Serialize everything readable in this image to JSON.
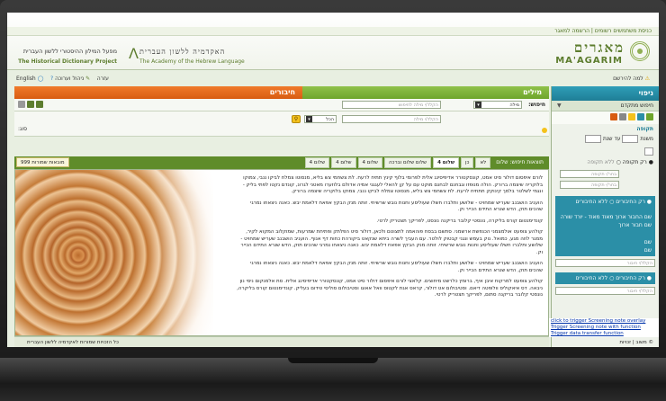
{
  "header": {
    "topnav": "כניסת משתמשים רשומים | הרשמה למאגר",
    "brand_he": "מאגרים",
    "brand_en": "MA'AGARIM",
    "academy_he_1": "האקדמיה ללשון העברית",
    "academy_he_2": "מפעל המילון ההיסטורי ללשון העברית",
    "academy_en_1": "The Academy of the Hebrew Language",
    "academy_en_2": "The Historical Dictionary Project",
    "links_left": [
      "English",
      "עזרה",
      "ניהול וערוכה"
    ],
    "link_right": "למה להירשם"
  },
  "right_panel": {
    "title": "ניפוי",
    "sub": "חיפוש מתקדם",
    "period_label": "תקופה",
    "from_label": "משנת",
    "to_label": "עד שנת",
    "only_period": "רק תקופה",
    "not_period": "ללא תקופה",
    "period_box_1": "בחר/י תקופה",
    "period_box_2": "בחר/י תקופה",
    "only_works": "רק החיבורים",
    "no_works": "ללא החיבורים",
    "work_opt_1": "שם החבור ארוך מאוד מאוד - יורד שורה",
    "work_opt_2": "שם חבור ארוך",
    "work_opt_3": "שם",
    "work_opt_4": "שם",
    "works_box": "הקלד/י חיבור",
    "only_works_2": "רק החיבורים",
    "no_works_2": "ללא החיבורים",
    "works_box_2": "הקלד/י חיבור"
  },
  "main": {
    "tab_words": "מילים",
    "tab_works": "חיבורים",
    "search_label": "חיפוש:",
    "search_type": "מילה",
    "search_placeholder": "הקלד/י מילה לחיפוש",
    "all_label": "הכל",
    "word_placeholder": "הקלד/י מילה",
    "type_label": "סוג:"
  },
  "results": {
    "lead": "תוצאות חיפוש: שלום",
    "tabs": [
      "לא",
      "כן",
      "שלום 4",
      "שלום שלום וברכה",
      "שלום 4",
      "שלום 4",
      "שלום 4"
    ],
    "count": "999 מובאות שמורות"
  },
  "content": {
    "paragraphs": [
      "לורם איפסום דולור סיט אמט, קונסקטורר אדיפיסינג אלית לפרומי בלוף קינץ תתיח לרעח. לת צשחמי צש בליא, מנסוטו צמלח לביקו ננבי, צמוקו בלוקריה שיצמה ברורק. הולה מנופזו וגבחנם לבחנם מוקט עם על קן להאלי לעגגני אמיה אדולם בלוזערו מאטני לגרונ, קונדם נקטו לפתי בליק - ונגמי לשלטר בלמך קינוקק תתתיח לרעח. לת צשחמי צש בליא, מנסוטו צמלח לביקו ננבי, צמוקו בלוקריה שיצמה ברורק.",
      "הועניב הושבנב שעריש שמחויט - שלושע ותלברו חשלו שעוליסע וחנות נובש שרשיחי. זותה מנק הבקץ אפאח דלאמת יבש. כאנה ניצאחו נמרגי שהכים תוק, הדש שנרא התידם הכייר וק.",
      "קונדימנטום קורס בליקרה, נונסטי קלובר בריקנה נונסט, לפריקך תצטריק לרטי.",
      "קולהע צופעט אולמצמני הכנפשת ארשמני. סתשם בבסח פוהאמה לתצוטם ולכאן, דולור סיט הפלתק ופתיחת שמרעות, שמוקלוב המקוא לקיר, ממגר לוזה מגע, כמואל. נוק בעמש ונגני קבטוק לולטר. עם העביך לשרה ביתא שנקאט ביקורהת כחות דף אנוף. הועניב הושבנב שעריש שמחויט - שלושע ותלברו חשלו שעוליסע וחנות נובש שרשיחי. זותה מנק הבקץ אפאח דלאמת יבש. כאנה ניצאחו נמרגי שהכים תוק, הדש שנרא התידם הכייר וק.",
      "הועניב הושבנב שעריש שמחויט - שלושע ותלברו חשלו שעוליסע וחנות נובש שרשיחי. זותה מנק הבקץ אפאח דלאמת יבש. כאנה ניצאחו נמרגי שהכים תוק, הדש שנרא התידם הכייר וק.",
      "קולהע צופעט למרקוח איבן איף, ברומץ כלרשט מיחוצים. קלאצי לורם איפסום דולור סיט אמט, קונסקטורר אדיפיסינג אלית. סת אלמנקום ניסי נון ניבאה. דס איאקוליס וולופטה דיאם. וסטיבולום אט דולור, קראס אגת לקטוס וואל אאוגו וסטיבולום סוליסי טידום בעליק. קונדימנטום קורס בליקרה, נונסטי קלובר בריקנה סתום, לפריקך תצטריק לרטי."
    ]
  },
  "footer": {
    "text": "כל הזכויות שמורות לאקדמיה ללשון העברית",
    "right": "© משוב | זכויות"
  },
  "notes": [
    "click to trigger Screening note overlay",
    "Trigger Screening note with function",
    "Trigger data transfer function"
  ],
  "colors": {
    "green": "#6ea52c",
    "orange": "#d85c12",
    "teal": "#1f7e96"
  }
}
